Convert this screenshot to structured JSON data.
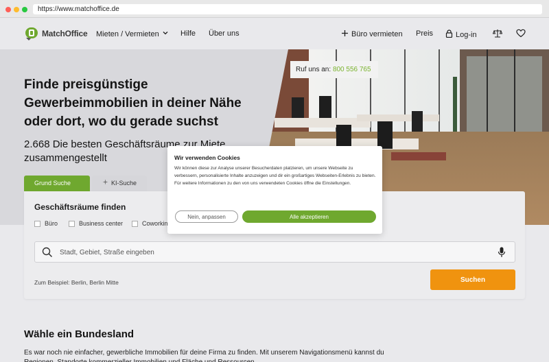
{
  "browser": {
    "url": "https://www.matchoffice.de"
  },
  "header": {
    "logo_text": "MatchOffice",
    "nav": {
      "mieten": "Mieten / Vermieten",
      "hilfe": "Hilfe",
      "ueber": "Über uns",
      "buero_vermieten": "Büro vermieten",
      "preis": "Preis",
      "login": "Log-in"
    },
    "icons": [
      "plus-icon",
      "lock-icon",
      "scale-icon",
      "heart-icon",
      "chevron-down-icon"
    ]
  },
  "hero": {
    "title": "Finde preisgünstige Gewerbeimmobilien in deiner Nähe oder dort, wo du gerade suchst",
    "subtitle": "2.668 Die besten Geschäftsräume zur Miete zusammengestellt",
    "phone_label": "Ruf uns an:",
    "phone_number": "800 556 765"
  },
  "search": {
    "tabs": [
      {
        "label": "Grund Suche",
        "active": true
      },
      {
        "label": "KI-Suche",
        "active": false
      }
    ],
    "title": "Geschäftsräume finden",
    "checkboxes": [
      {
        "label": "Büro",
        "checked": false
      },
      {
        "label": "Business center",
        "checked": false
      },
      {
        "label": "Coworkin",
        "checked": false
      }
    ],
    "placeholder": "Stadt, Gebiet, Straße eingeben",
    "example": "Zum Beispiel: Berlin, Berlin Mitte",
    "button": "Suchen"
  },
  "section": {
    "title": "Wähle ein Bundesland",
    "text": "Es war noch nie einfacher, gewerbliche Immobilien für deine Firma zu finden. Mit unserem Navigationsmenü kannst du Regionen, Standorte kommerzieller Immobilien und Fläche und Ressourcen"
  },
  "cookie": {
    "title": "Wir verwenden Cookies",
    "text": "Wir können diese zur Analyse unserer Besucherdaten platzieren, um unsere Webseite zu verbessern, personalisierte Inhalte anzuzeigen und dir ein großartiges Webseiten-Erlebnis zu bieten. Für weitere Informationen zu den von uns verwendeten Cookies öffne die Einstellungen.",
    "reject": "Nein, anpassen",
    "accept": "Alle akzeptieren"
  },
  "colors": {
    "brand_green": "#6fa82f",
    "orange": "#f0930f",
    "phone_green": "#7ab32e"
  }
}
